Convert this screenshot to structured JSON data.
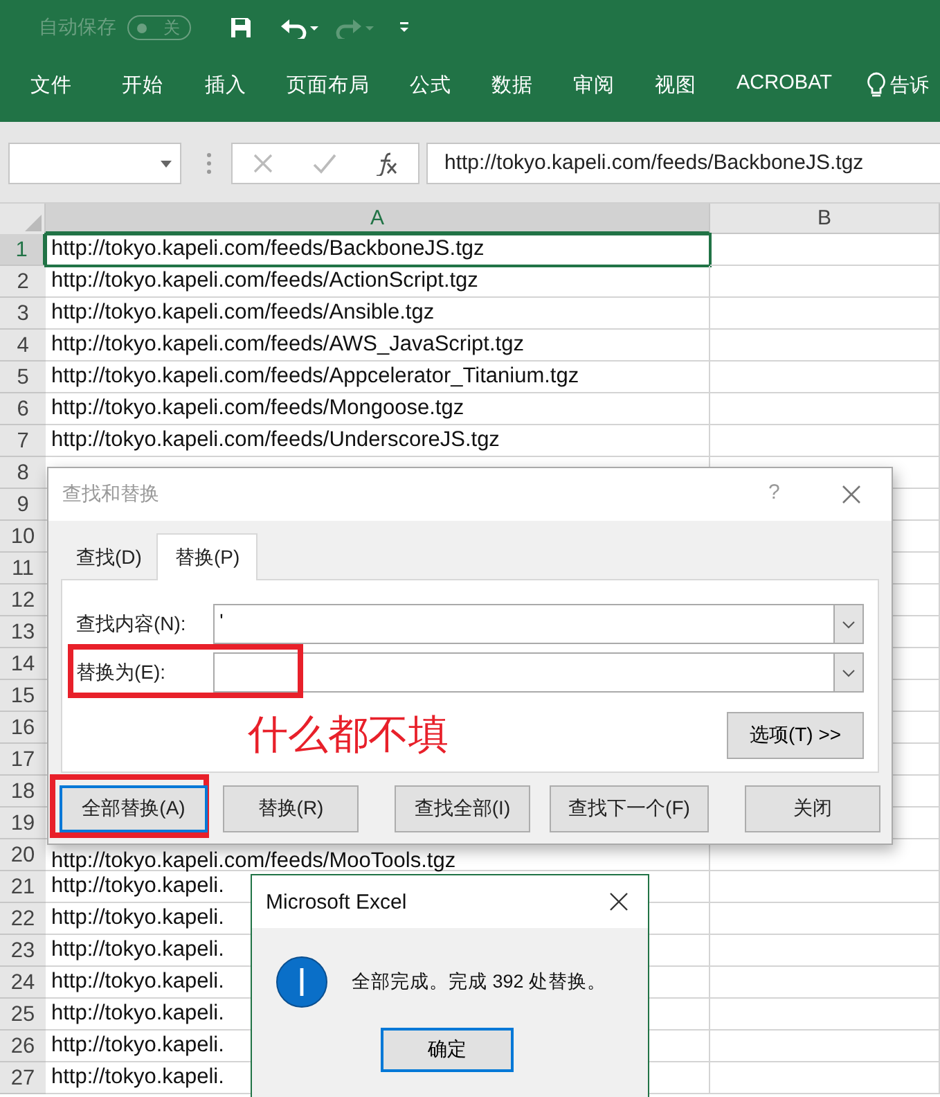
{
  "quick_access": {
    "autosave_label": "自动保存",
    "autosave_state": "关",
    "autosave_on": false,
    "redo_disabled": true
  },
  "ribbon_tabs": [
    "文件",
    "开始",
    "插入",
    "页面布局",
    "公式",
    "数据",
    "审阅",
    "视图",
    "ACROBAT"
  ],
  "tell_me": "告诉",
  "formula_bar": {
    "content": "http://tokyo.kapeli.com/feeds/BackboneJS.tgz"
  },
  "columns": [
    "A",
    "B"
  ],
  "rows": [
    {
      "number": "1",
      "cell_a": "http://tokyo.kapeli.com/feeds/BackboneJS.tgz",
      "selected": true
    },
    {
      "number": "2",
      "cell_a": "http://tokyo.kapeli.com/feeds/ActionScript.tgz",
      "selected": false
    },
    {
      "number": "3",
      "cell_a": "http://tokyo.kapeli.com/feeds/Ansible.tgz",
      "selected": false
    },
    {
      "number": "4",
      "cell_a": "http://tokyo.kapeli.com/feeds/AWS_JavaScript.tgz",
      "selected": false
    },
    {
      "number": "5",
      "cell_a": "http://tokyo.kapeli.com/feeds/Appcelerator_Titanium.tgz",
      "selected": false
    },
    {
      "number": "6",
      "cell_a": "http://tokyo.kapeli.com/feeds/Mongoose.tgz",
      "selected": false
    },
    {
      "number": "7",
      "cell_a": "http://tokyo.kapeli.com/feeds/UnderscoreJS.tgz",
      "selected": false
    },
    {
      "number": "8",
      "selected": false
    },
    {
      "number": "9",
      "selected": false
    },
    {
      "number": "10",
      "selected": false
    },
    {
      "number": "11",
      "selected": false
    },
    {
      "number": "12",
      "selected": false
    },
    {
      "number": "13",
      "selected": false
    },
    {
      "number": "14",
      "selected": false
    },
    {
      "number": "15",
      "selected": false
    },
    {
      "number": "16",
      "selected": false
    },
    {
      "number": "17",
      "selected": false
    },
    {
      "number": "18",
      "selected": false
    },
    {
      "number": "19",
      "selected": false
    },
    {
      "number": "20",
      "cell_a": "http://tokyo.kapeli.com/feeds/MooTools.tgz",
      "selected": false
    },
    {
      "number": "21",
      "cell_a": "http://tokyo.kapeli.",
      "selected": false
    },
    {
      "number": "22",
      "cell_a": "http://tokyo.kapeli.",
      "selected": false
    },
    {
      "number": "23",
      "cell_a": "http://tokyo.kapeli.",
      "selected": false
    },
    {
      "number": "24",
      "cell_a": "http://tokyo.kapeli.",
      "selected": false
    },
    {
      "number": "25",
      "cell_a": "http://tokyo.kapeli.",
      "selected": false
    },
    {
      "number": "26",
      "cell_a": "http://tokyo.kapeli.",
      "selected": false
    },
    {
      "number": "27",
      "cell_a": "http://tokyo.kapeli.",
      "selected": false
    }
  ],
  "find_replace": {
    "title": "查找和替换",
    "help": "?",
    "tabs": [
      {
        "label": "查找(D)",
        "selected": false
      },
      {
        "label": "替换(P)",
        "selected": true
      }
    ],
    "fields": [
      {
        "label": "查找内容(N):",
        "value": "'",
        "highlighted": false
      },
      {
        "label": "替换为(E):",
        "highlighted": true
      }
    ],
    "annotation": "什么都不填",
    "options_button": "选项(T) >>",
    "buttons": [
      {
        "label": "全部替换(A)",
        "default": true,
        "highlighted": true
      },
      {
        "label": "替换(R)",
        "default": false,
        "highlighted": false
      },
      {
        "label": "查找全部(I)",
        "default": false,
        "highlighted": false
      },
      {
        "label": "查找下一个(F)",
        "default": false,
        "highlighted": false
      },
      {
        "label": "关闭",
        "default": false,
        "highlighted": false
      }
    ]
  },
  "message_box": {
    "title": "Microsoft Excel",
    "message": "全部完成。完成 392 处替换。",
    "ok_button": "确定"
  }
}
